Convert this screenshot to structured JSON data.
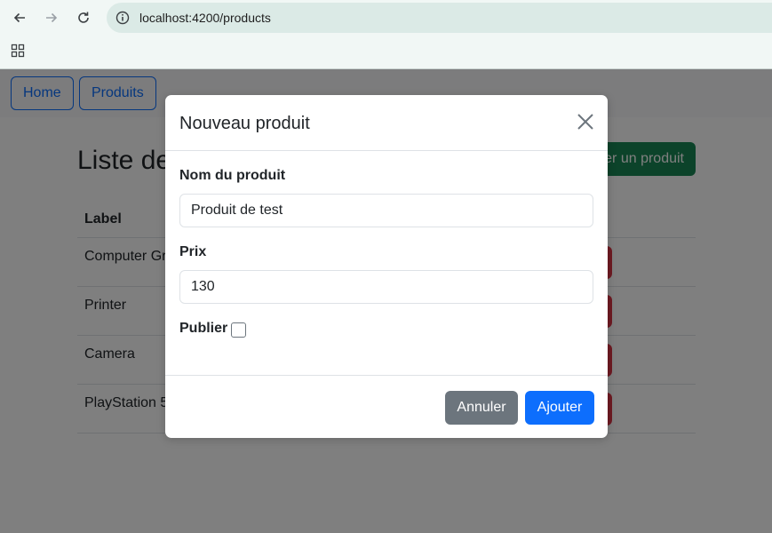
{
  "browser": {
    "url": "localhost:4200/products",
    "icons": {
      "back": "arrow-left-icon",
      "forward": "arrow-right-icon",
      "reload": "reload-icon",
      "info": "info-icon",
      "apps": "apps-grid-icon"
    }
  },
  "nav": {
    "home_label": "Home",
    "products_label": "Produits"
  },
  "page": {
    "title": "Liste des produits",
    "add_button_label": "Ajouter un produit",
    "table": {
      "header_label": "Label",
      "rows": [
        {
          "label": "Computer Gr"
        },
        {
          "label": "Printer"
        },
        {
          "label": "Camera"
        },
        {
          "label": "PlayStation 5"
        }
      ]
    }
  },
  "modal": {
    "title": "Nouveau produit",
    "name_label": "Nom du produit",
    "name_value": "Produit de test",
    "price_label": "Prix",
    "price_value": "130",
    "publish_label": "Publier",
    "publish_checked": false,
    "cancel_label": "Annuler",
    "submit_label": "Ajouter"
  },
  "colors": {
    "primary": "#0d6efd",
    "success": "#198754",
    "danger": "#dc3545",
    "secondary": "#6c757d"
  }
}
